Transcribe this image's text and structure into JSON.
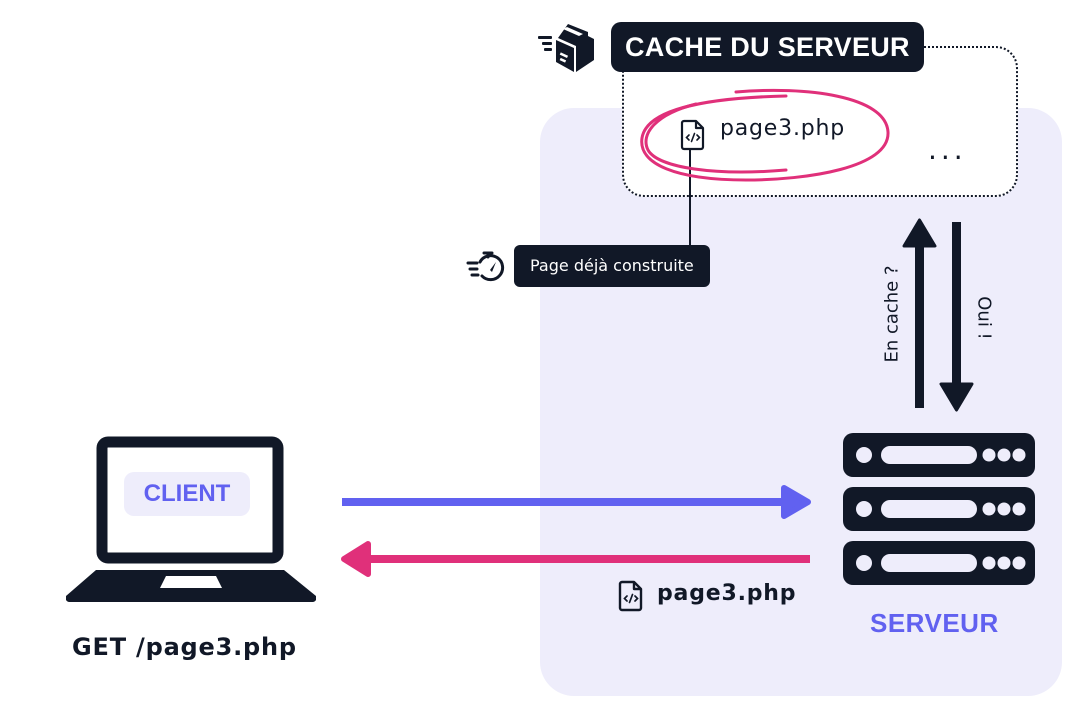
{
  "cache": {
    "title": "CACHE DU SERVEUR",
    "icon": "package-box-icon",
    "file_label": "page3.php",
    "file_icon": "code-file-icon",
    "more_indicator": "...",
    "highlight_color": "#e0307a"
  },
  "tooltip": {
    "icon": "stopwatch-fast-icon",
    "text": "Page déjà construite"
  },
  "cache_check": {
    "request_label": "En cache ?",
    "response_label": "Oui !"
  },
  "client": {
    "badge": "CLIENT",
    "icon": "laptop-icon",
    "caption": "GET /page3.php"
  },
  "server": {
    "icon": "server-rack-icon",
    "caption": "SERVEUR"
  },
  "response": {
    "file_icon": "code-file-icon",
    "file_label": "page3.php"
  },
  "colors": {
    "dark": "#111827",
    "request_arrow": "#6161f0",
    "response_arrow": "#e0307a",
    "panel_bg": "#eeedfb",
    "accent_text": "#6161f0"
  }
}
